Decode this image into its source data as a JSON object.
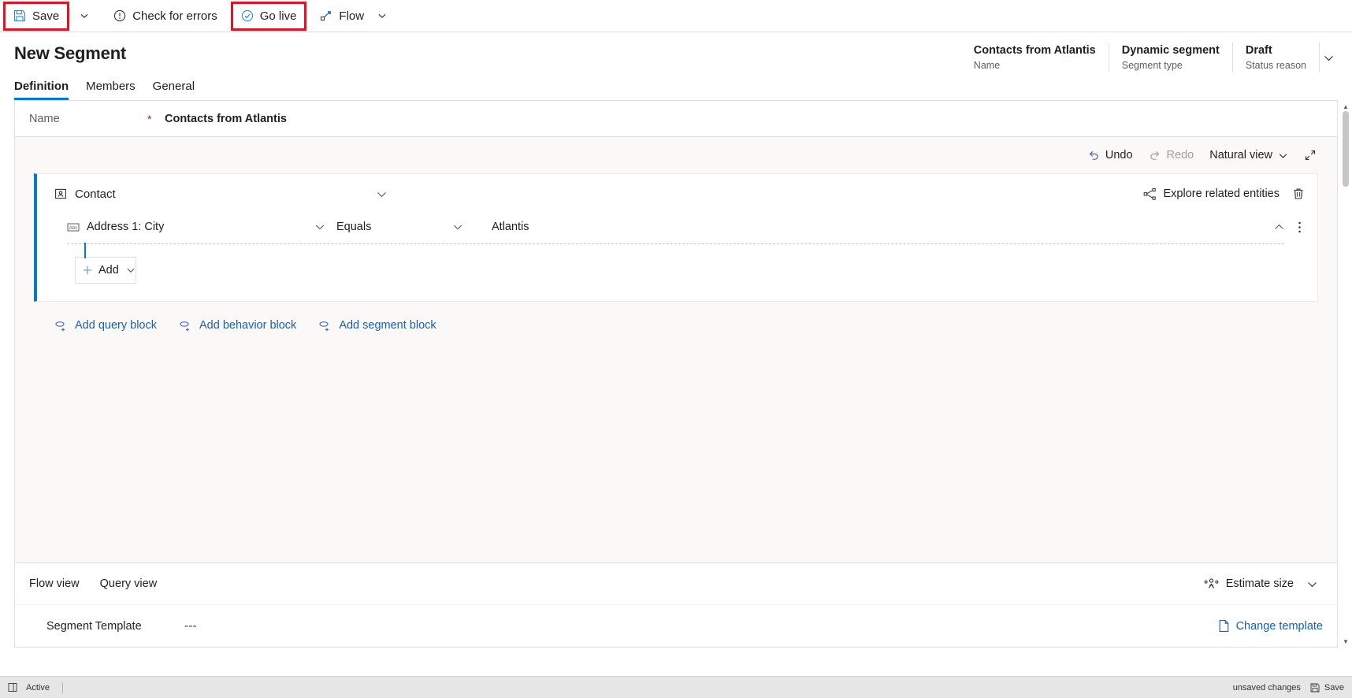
{
  "toolbar": {
    "save_label": "Save",
    "save_icon": "save-icon",
    "save_caret_icon": "chevron-down-icon",
    "check_errors_label": "Check for errors",
    "check_errors_icon": "error-circle-icon",
    "go_live_label": "Go live",
    "go_live_icon": "check-circle-icon",
    "flow_label": "Flow",
    "flow_icon": "flow-icon",
    "flow_caret_icon": "chevron-down-icon",
    "highlight_color": "#e81123"
  },
  "header": {
    "title": "New Segment",
    "meta": [
      {
        "value": "Contacts from Atlantis",
        "label": "Name"
      },
      {
        "value": "Dynamic segment",
        "label": "Segment type"
      },
      {
        "value": "Draft",
        "label": "Status reason"
      }
    ],
    "meta_caret_icon": "chevron-down-icon"
  },
  "tabs": [
    {
      "label": "Definition",
      "active": true
    },
    {
      "label": "Members",
      "active": false
    },
    {
      "label": "General",
      "active": false
    }
  ],
  "name_field": {
    "label": "Name",
    "required_marker": "*",
    "value": "Contacts from Atlantis"
  },
  "canvas_toolbar": {
    "undo_label": "Undo",
    "undo_icon": "undo-icon",
    "redo_label": "Redo",
    "redo_icon": "redo-icon",
    "view_label": "Natural view",
    "view_caret_icon": "chevron-down-icon",
    "expand_icon": "expand-diagonal-icon"
  },
  "query_block": {
    "entity_label": "Contact",
    "entity_icon": "contact-icon",
    "collapse_icon": "chevron-down-icon",
    "explore_label": "Explore related entities",
    "explore_icon": "share-network-icon",
    "delete_icon": "trash-icon",
    "condition": {
      "attribute": "Address 1: City",
      "attribute_icon": "text-field-icon",
      "attribute_caret_icon": "chevron-down-icon",
      "operator": "Equals",
      "operator_caret_icon": "chevron-down-icon",
      "value": "Atlantis",
      "collapse_icon": "chevron-up-icon",
      "more_icon": "more-vertical-icon"
    },
    "add_label": "Add",
    "add_icon": "plus-icon",
    "add_caret_icon": "chevron-down-icon"
  },
  "block_links": [
    {
      "label": "Add query block",
      "icon": "query-block-icon"
    },
    {
      "label": "Add behavior block",
      "icon": "query-block-icon"
    },
    {
      "label": "Add segment block",
      "icon": "query-block-icon"
    }
  ],
  "footer": {
    "views": [
      {
        "label": "Flow view"
      },
      {
        "label": "Query view"
      }
    ],
    "estimate_label": "Estimate size",
    "estimate_icon": "people-group-icon",
    "estimate_caret_icon": "chevron-down-icon",
    "template_label": "Segment Template",
    "template_value": "---",
    "change_template_label": "Change template",
    "change_template_icon": "document-icon"
  },
  "statusbar": {
    "layout_icon": "layout-icon",
    "state_label": "Active",
    "unsaved_label": "unsaved changes",
    "save_label": "Save",
    "save_icon": "save-icon"
  }
}
